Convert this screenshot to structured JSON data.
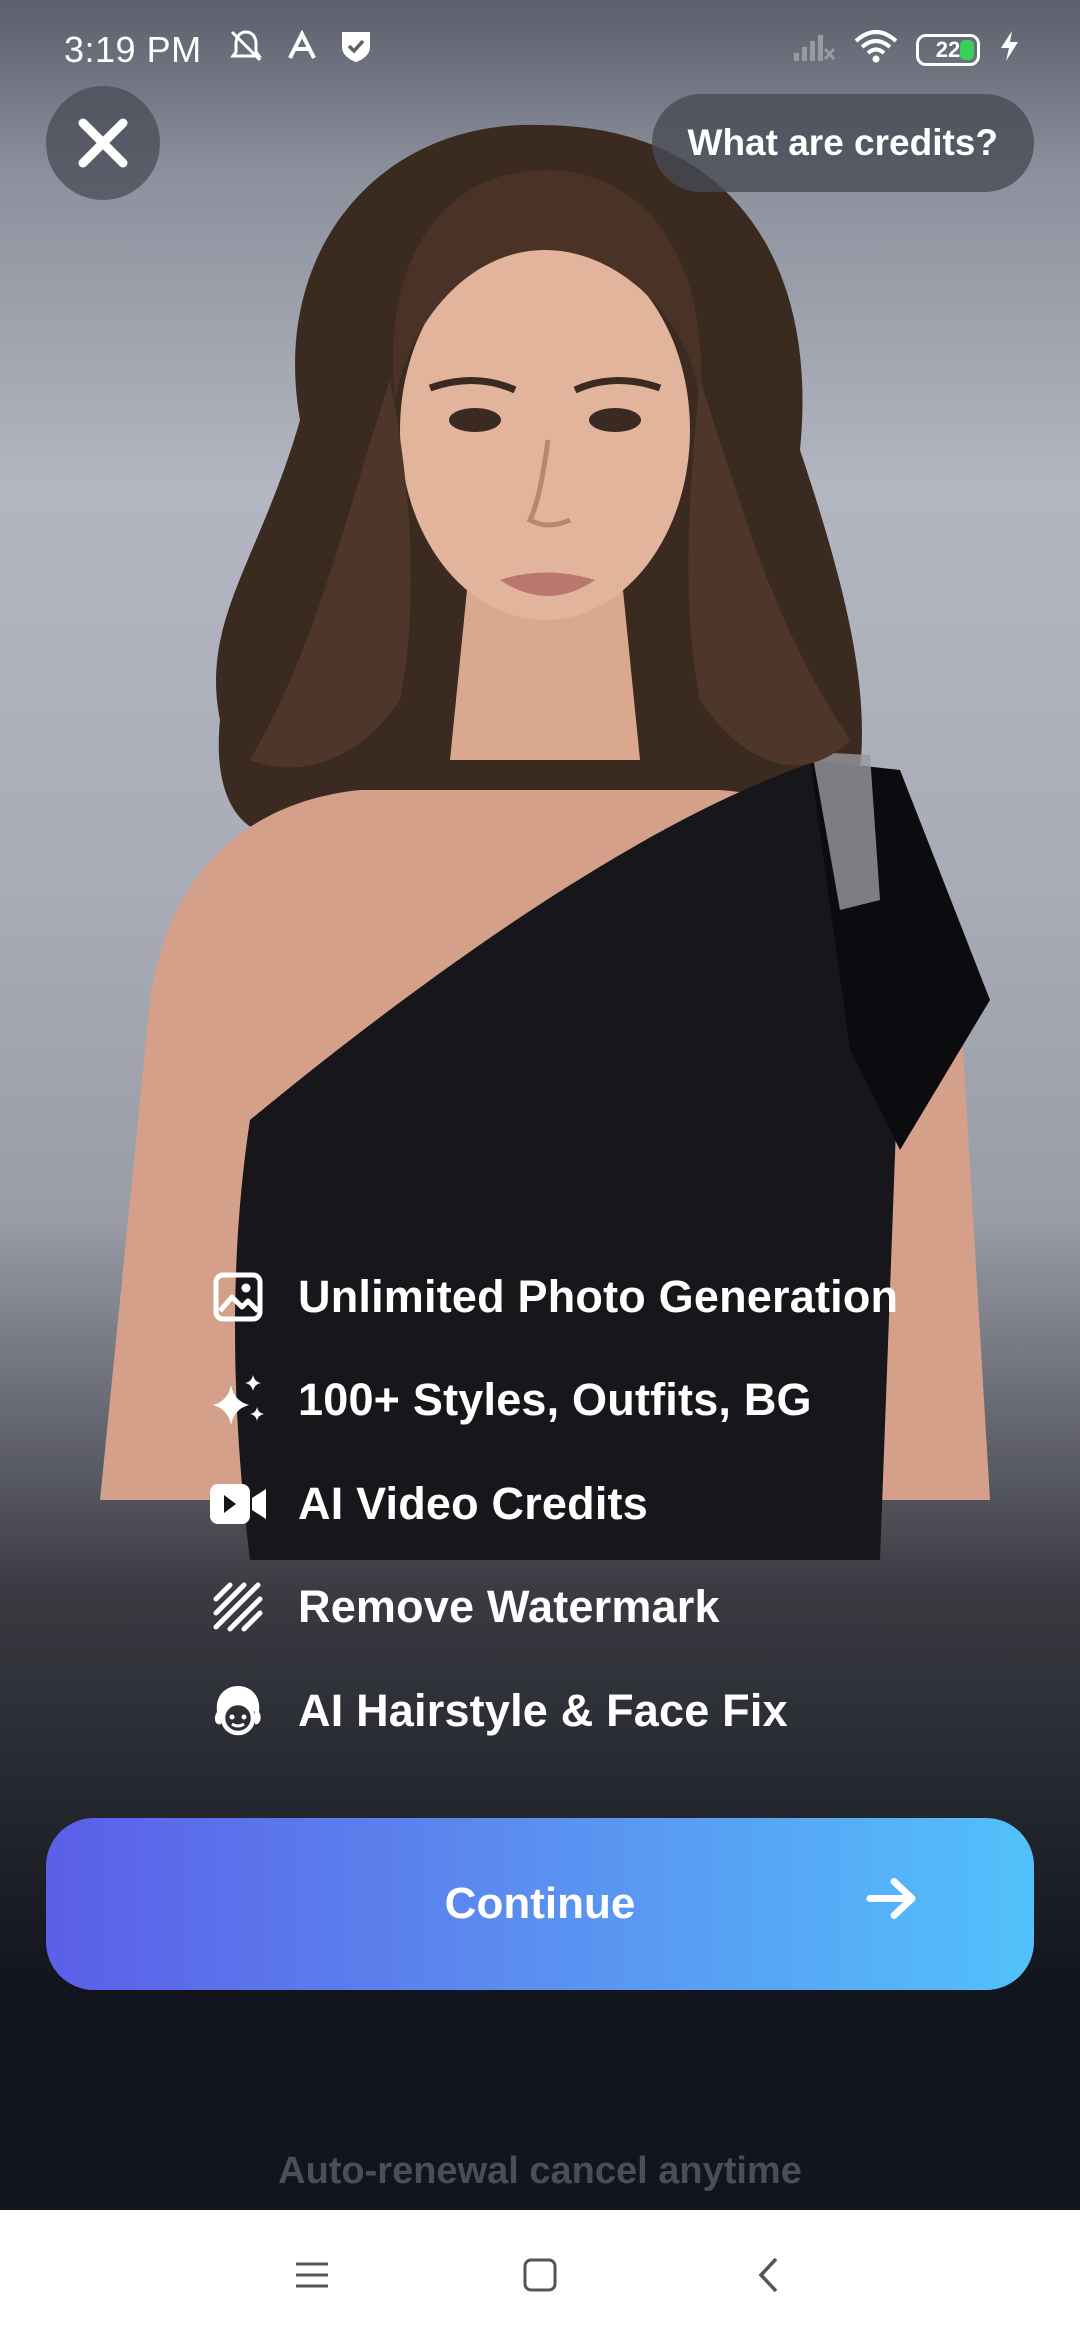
{
  "status_bar": {
    "time": "3:19 PM",
    "battery_level": "22",
    "icons": [
      "mute-bell-icon",
      "font-a-icon",
      "shield-check-icon",
      "signal-icon",
      "wifi-icon",
      "battery-icon",
      "charging-icon"
    ]
  },
  "header": {
    "close_icon": "close-icon",
    "credits_label": "What are credits?"
  },
  "features": [
    {
      "icon": "image-icon",
      "label": "Unlimited Photo Generation"
    },
    {
      "icon": "sparkles-icon",
      "label": "100+ Styles, Outfits, BG"
    },
    {
      "icon": "video-camera-icon",
      "label": "AI Video Credits"
    },
    {
      "icon": "watermark-icon",
      "label": "Remove Watermark"
    },
    {
      "icon": "hairstyle-face-icon",
      "label": "AI Hairstyle & Face Fix"
    }
  ],
  "cta": {
    "label": "Continue",
    "icon": "arrow-right-icon",
    "gradient": [
      "#5b5fe8",
      "#52c1fb"
    ]
  },
  "footer": {
    "renewal_text": "Auto-renewal cancel anytime"
  },
  "nav_bar": {
    "items": [
      "menu-icon",
      "home-icon",
      "back-icon"
    ]
  }
}
